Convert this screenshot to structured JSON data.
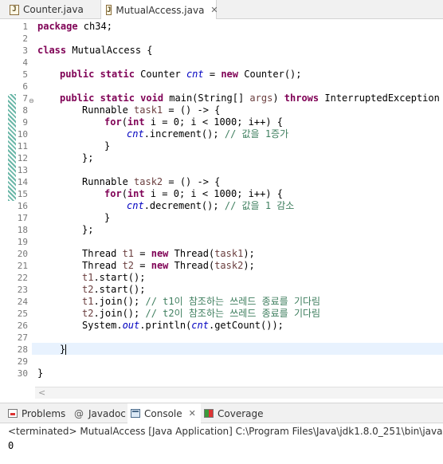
{
  "tabs": [
    {
      "label": "Counter.java",
      "active": false,
      "icon": "java-file-icon"
    },
    {
      "label": "MutualAccess.java",
      "active": true,
      "icon": "java-file-icon",
      "close": "✕"
    }
  ],
  "gutter": {
    "numbers": [
      "1",
      "2",
      "3",
      "4",
      "5",
      "6",
      "7",
      "8",
      "9",
      "10",
      "11",
      "12",
      "13",
      "14",
      "15",
      "16",
      "17",
      "18",
      "19",
      "20",
      "21",
      "22",
      "23",
      "24",
      "25",
      "26",
      "27",
      "28",
      "29",
      "30"
    ],
    "fold_marker": "⊖"
  },
  "code": {
    "l1_kw": "package",
    "l1_rest": " ch34;",
    "l3_kw": "class",
    "l3_rest": " MutualAccess {",
    "l5_kw1": "public static",
    "l5_t1": " Counter ",
    "l5_fld": "cnt",
    "l5_t2": " = ",
    "l5_kw2": "new",
    "l5_t3": " Counter();",
    "l7_kw1": "public static void",
    "l7_t1": " main(String[] ",
    "l7_lv": "args",
    "l7_t2": ") ",
    "l7_kw2": "throws",
    "l7_t3": " InterruptedException ",
    "l7_brace": "{",
    "l8_t1": "Runnable ",
    "l8_lv": "task1",
    "l8_t2": " = () -> {",
    "l9_kw1": "for",
    "l9_t1": "(",
    "l9_kw2": "int",
    "l9_t2": " i = 0; i < 1000; i++) {",
    "l10_fld": "cnt",
    "l10_t1": ".increment(); ",
    "l10_cm": "// 값을 1증가",
    "l11": "}",
    "l12": "};",
    "l14_t1": "Runnable ",
    "l14_lv": "task2",
    "l14_t2": " = () -> {",
    "l15_kw1": "for",
    "l15_t1": "(",
    "l15_kw2": "int",
    "l15_t2": " i = 0; i < 1000; i++) {",
    "l16_fld": "cnt",
    "l16_t1": ".decrement(); ",
    "l16_cm": "// 값을 1 감소",
    "l17": "}",
    "l18": "};",
    "l20_t1": "Thread ",
    "l20_lv": "t1",
    "l20_t2": " = ",
    "l20_kw": "new",
    "l20_t3": " Thread(",
    "l20_lv2": "task1",
    "l20_t4": ");",
    "l21_t1": "Thread ",
    "l21_lv": "t2",
    "l21_t2": " = ",
    "l21_kw": "new",
    "l21_t3": " Thread(",
    "l21_lv2": "task2",
    "l21_t4": ");",
    "l22_lv": "t1",
    "l22_t1": ".start();",
    "l23_lv": "t2",
    "l23_t1": ".start();",
    "l24_lv": "t1",
    "l24_t1": ".join(); ",
    "l24_cm": "// t1이 참조하는 쓰레드 종료를 기다림",
    "l25_lv": "t2",
    "l25_t1": ".join(); ",
    "l25_cm": "// t2이 참조하는 쓰레드 종료를 기다림",
    "l26_t1": "System.",
    "l26_fld1": "out",
    "l26_t2": ".println(",
    "l26_fld2": "cnt",
    "l26_t3": ".getCount());",
    "l28": "}",
    "l30": "}"
  },
  "scrollbar": {
    "left_arrow": "<"
  },
  "console": {
    "tabs": [
      {
        "label": "Problems",
        "icon": "problems-icon"
      },
      {
        "label": "Javadoc",
        "icon": "at-icon",
        "glyph": "@"
      },
      {
        "label": "Console",
        "icon": "console-icon",
        "close": "✕",
        "active": true
      },
      {
        "label": "Coverage",
        "icon": "coverage-icon"
      }
    ],
    "status": "<terminated> MutualAccess [Java Application] C:\\Program Files\\Java\\jdk1.8.0_251\\bin\\javaw.exe",
    "output": "0"
  },
  "colors": {
    "keyword": "#7f0055",
    "field": "#0000c0",
    "comment": "#3f7f5f",
    "current_line": "#e8f2fe"
  }
}
